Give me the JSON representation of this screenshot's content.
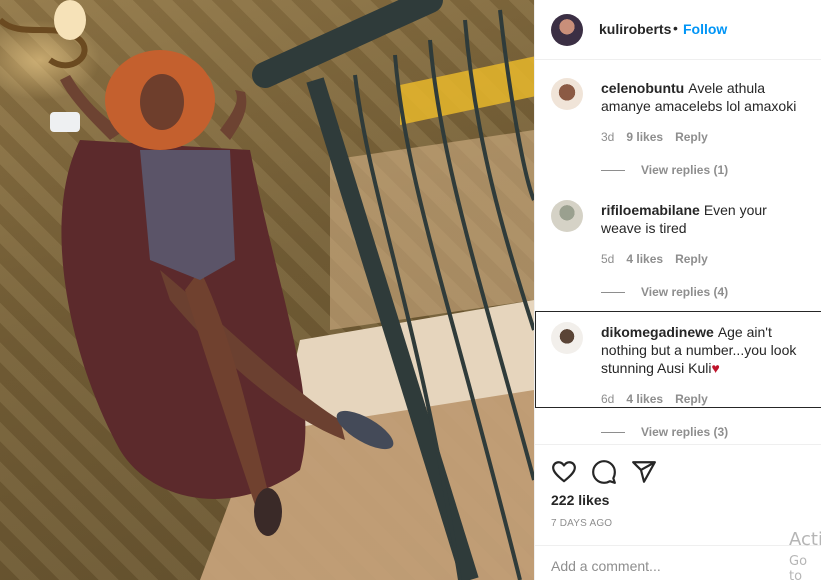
{
  "post": {
    "username": "kuliroberts",
    "separator": "•",
    "follow_label": "Follow"
  },
  "comments": [
    {
      "user": "celenobuntu",
      "text": "Avele athula amanye amacelebs lol amaxoki",
      "age": "3d",
      "likes": "9 likes",
      "reply_label": "Reply",
      "view_replies": "View replies (1)"
    },
    {
      "user": "rifiloemabilane",
      "text": "Even your weave is tired",
      "age": "5d",
      "likes": "4 likes",
      "reply_label": "Reply",
      "view_replies": "View replies (4)"
    },
    {
      "user": "dikomegadinewe",
      "text": "Age ain't nothing but a number...you look stunning Ausi Kuli",
      "heart": "♥",
      "age": "6d",
      "likes": "4 likes",
      "reply_label": "Reply",
      "view_replies": "View replies (3)"
    }
  ],
  "actions": {
    "icons": [
      "heart-icon",
      "comment-icon",
      "share-icon"
    ],
    "likes_count": "222 likes",
    "posted": "7 DAYS AGO",
    "comment_placeholder": "Add a comment..."
  },
  "watermark": {
    "line1": "Acti",
    "line2": "Go to"
  },
  "colors": {
    "link_blue": "#0095f6",
    "heart_red": "#c0142b",
    "muted": "#8e8e8e"
  }
}
